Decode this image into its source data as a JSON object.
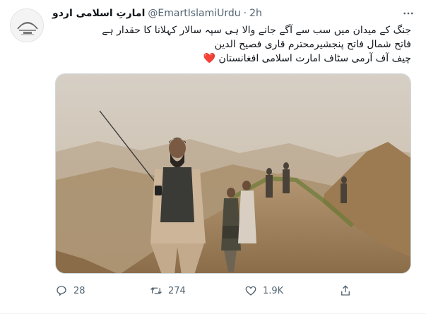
{
  "tweet": {
    "display_name": "امارتِ اسلامی اردو",
    "handle": "@EmartIslamiUrdu",
    "separator": "·",
    "timestamp": "2h",
    "avatar_icon": "emblem-logo-icon",
    "lines": [
      "جنگ کے میدان میں سب سے آگے جانے والا ہی سپہ سالار کہلانا کا حقدار ہے",
      "فاتح شمال فاتح پنجشیرمحترم قاری فصیح الدین",
      "چیف آف آرمی سٹاف امارت اسلامی افغانستان"
    ],
    "heart_symbol": "❤️"
  },
  "actions": {
    "reply_count": "28",
    "retweet_count": "274",
    "like_count": "1.9K",
    "reply_icon": "reply-icon",
    "retweet_icon": "retweet-icon",
    "like_icon": "heart-icon",
    "share_icon": "share-icon"
  },
  "colors": {
    "text": "#0f1419",
    "secondary": "#536471",
    "heart": "#e0245e",
    "border": "#cfd9de"
  }
}
